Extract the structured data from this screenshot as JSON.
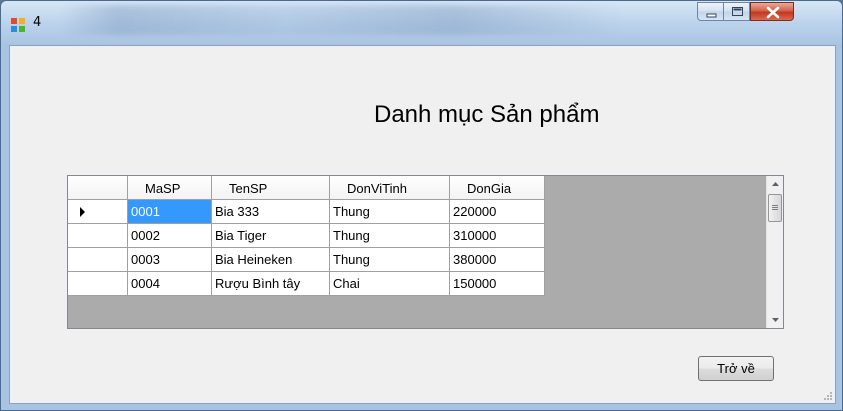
{
  "window": {
    "title": "4",
    "minimize_icon": "minimize-icon",
    "maximize_icon": "maximize-icon",
    "close_icon": "close-icon"
  },
  "form": {
    "heading": "Danh mục Sản phẩm",
    "back_button_label": "Trở về"
  },
  "grid": {
    "columns": [
      "MaSP",
      "TenSP",
      "DonViTinh",
      "DonGia"
    ],
    "rows": [
      [
        "0001",
        "Bia 333",
        "Thung",
        "220000"
      ],
      [
        "0002",
        "Bia Tiger",
        "Thung",
        "310000"
      ],
      [
        "0003",
        "Bia Heineken",
        "Thung",
        "380000"
      ],
      [
        "0004",
        "Rượu Bình tây",
        "Chai",
        "150000"
      ]
    ],
    "current_row_icon": "current-row-arrow-icon",
    "selected_cell": "0001"
  },
  "colors": {
    "selection": "#3399ff",
    "grid_background": "#ababab",
    "form_background": "#f0f0f0",
    "close_button": "#c0391f"
  }
}
